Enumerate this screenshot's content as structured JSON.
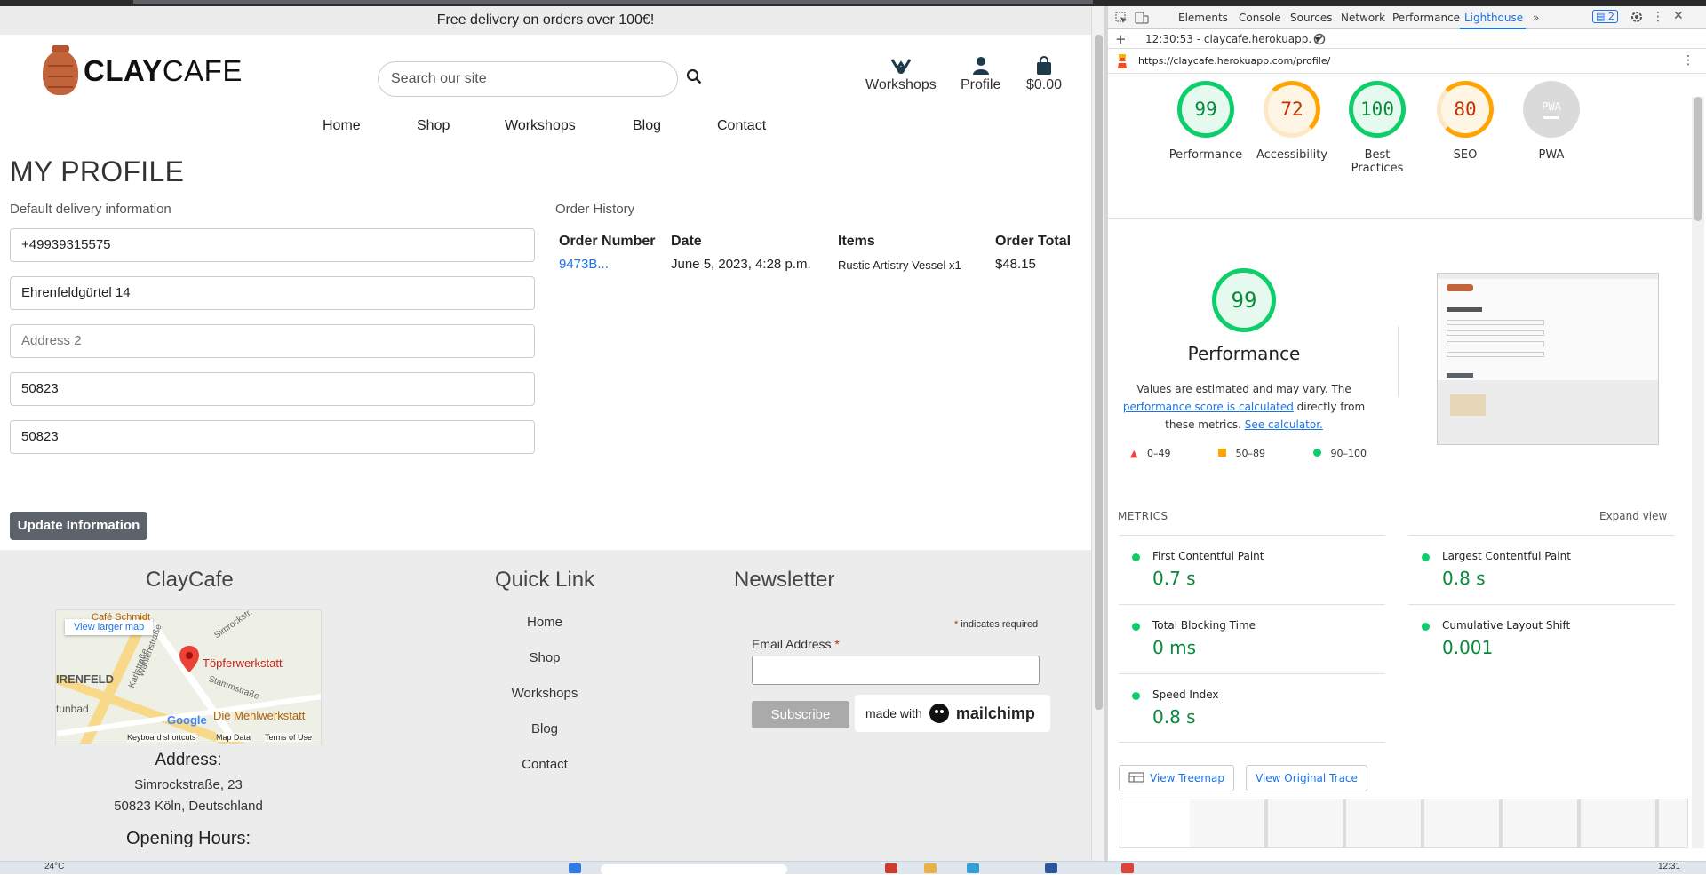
{
  "site": {
    "banner": "Free delivery on orders over 100€!",
    "logo": {
      "bold": "CLAY",
      "rest": "CAFE"
    },
    "search_placeholder": "Search our site",
    "header_links": {
      "workshops": "Workshops",
      "profile": "Profile",
      "bag_total": "$0.00"
    },
    "nav": [
      "Home",
      "Shop",
      "Workshops",
      "Blog",
      "Contact"
    ],
    "page_title": "MY PROFILE",
    "delivery": {
      "title": "Default delivery information",
      "phone": "+49939315575",
      "address1": "Ehrenfeldgürtel 14",
      "address2_placeholder": "Address 2",
      "field4": "50823",
      "field5": "50823",
      "update_button": "Update Information"
    },
    "orders": {
      "title": "Order History",
      "headers": [
        "Order Number",
        "Date",
        "Items",
        "Order Total"
      ],
      "rows": [
        {
          "number": "9473B...",
          "date": "June 5, 2023, 4:28 p.m.",
          "items": "Rustic Artistry Vessel x1",
          "total": "$48.15"
        }
      ]
    },
    "footer": {
      "brand_title": "ClayCafe",
      "map": {
        "larger_link": "View larger map",
        "place1": "Töpferwerkstatt",
        "place2": "Die Mehlwerkstatt",
        "district": "IRENFELD",
        "street1": "Stammstraße",
        "street2": "Simrockstr.",
        "street3": "Wahlenstraße",
        "street4": "Karlstraße",
        "cafe": "Café Schmidt",
        "tunbad": "tunbad",
        "google": "Google",
        "shortcuts": "Keyboard shortcuts",
        "mapdata": "Map Data",
        "terms": "Terms of Use"
      },
      "address_label": "Address:",
      "address_line1": "Simrockstraße, 23",
      "address_line2": "50823 Köln, Deutschland",
      "hours_label": "Opening Hours:",
      "quick_title": "Quick Link",
      "quick_links": [
        "Home",
        "Shop",
        "Workshops",
        "Blog",
        "Contact"
      ],
      "newsletter_title": "Newsletter",
      "required_note": "indicates required",
      "email_label": "Email Address",
      "subscribe": "Subscribe",
      "made_with": "made with",
      "mailchimp": "mailchimp"
    }
  },
  "devtools": {
    "tabs": [
      "Elements",
      "Console",
      "Sources",
      "Network",
      "Performance",
      "Lighthouse"
    ],
    "active_tab": "Lighthouse",
    "issues_count": "2",
    "report_time": "12:30:53 - claycafe.herokuapp.",
    "url": "https://claycafe.herokuapp.com/profile/",
    "scores": [
      {
        "label": "Performance",
        "value": "99",
        "color": "#0cce6b"
      },
      {
        "label": "Accessibility",
        "value": "72",
        "color": "#ffa400"
      },
      {
        "label": "Best Practices",
        "value": "100",
        "color": "#0cce6b"
      },
      {
        "label": "SEO",
        "value": "80",
        "color": "#ffa400"
      },
      {
        "label": "PWA",
        "value": "PWA",
        "color": "#cccccc"
      }
    ],
    "performance": {
      "score": "99",
      "title": "Performance",
      "desc_1": "Values are estimated and may vary. The ",
      "desc_link1": "performance score is calculated",
      "desc_2": " directly from these metrics. ",
      "desc_link2": "See calculator."
    },
    "legend": [
      "0–49",
      "50–89",
      "90–100"
    ],
    "metrics_title": "METRICS",
    "expand_view": "Expand view",
    "metrics": [
      {
        "name": "First Contentful Paint",
        "value": "0.7 s"
      },
      {
        "name": "Largest Contentful Paint",
        "value": "0.8 s"
      },
      {
        "name": "Total Blocking Time",
        "value": "0 ms"
      },
      {
        "name": "Cumulative Layout Shift",
        "value": "0.001"
      },
      {
        "name": "Speed Index",
        "value": "0.8 s"
      }
    ],
    "buttons": {
      "treemap": "View Treemap",
      "trace": "View Original Trace"
    }
  },
  "taskbar": {
    "temp": "24°C",
    "clock": "12:31"
  }
}
